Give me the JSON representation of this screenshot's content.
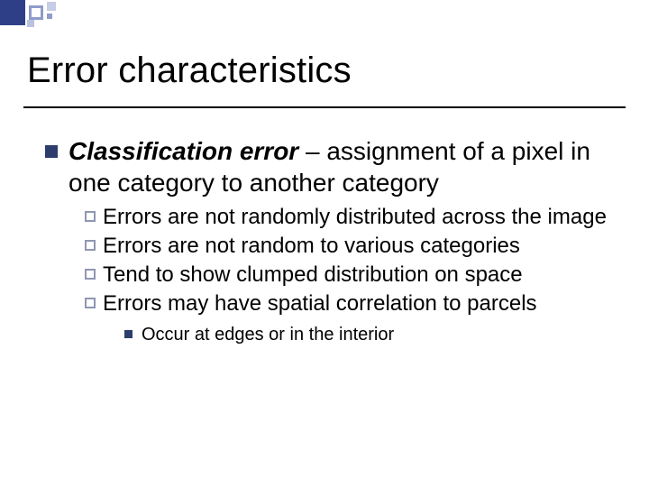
{
  "title": "Error characteristics",
  "main": {
    "term": "Classification error",
    "definition": " – assignment of a pixel in one category to another category"
  },
  "sub": [
    "Errors are not randomly distributed across the image",
    "Errors are not random to various categories",
    "Tend to show clumped distribution on space",
    "Errors may have spatial correlation to parcels"
  ],
  "subsub": [
    "Occur at edges or in the interior"
  ]
}
